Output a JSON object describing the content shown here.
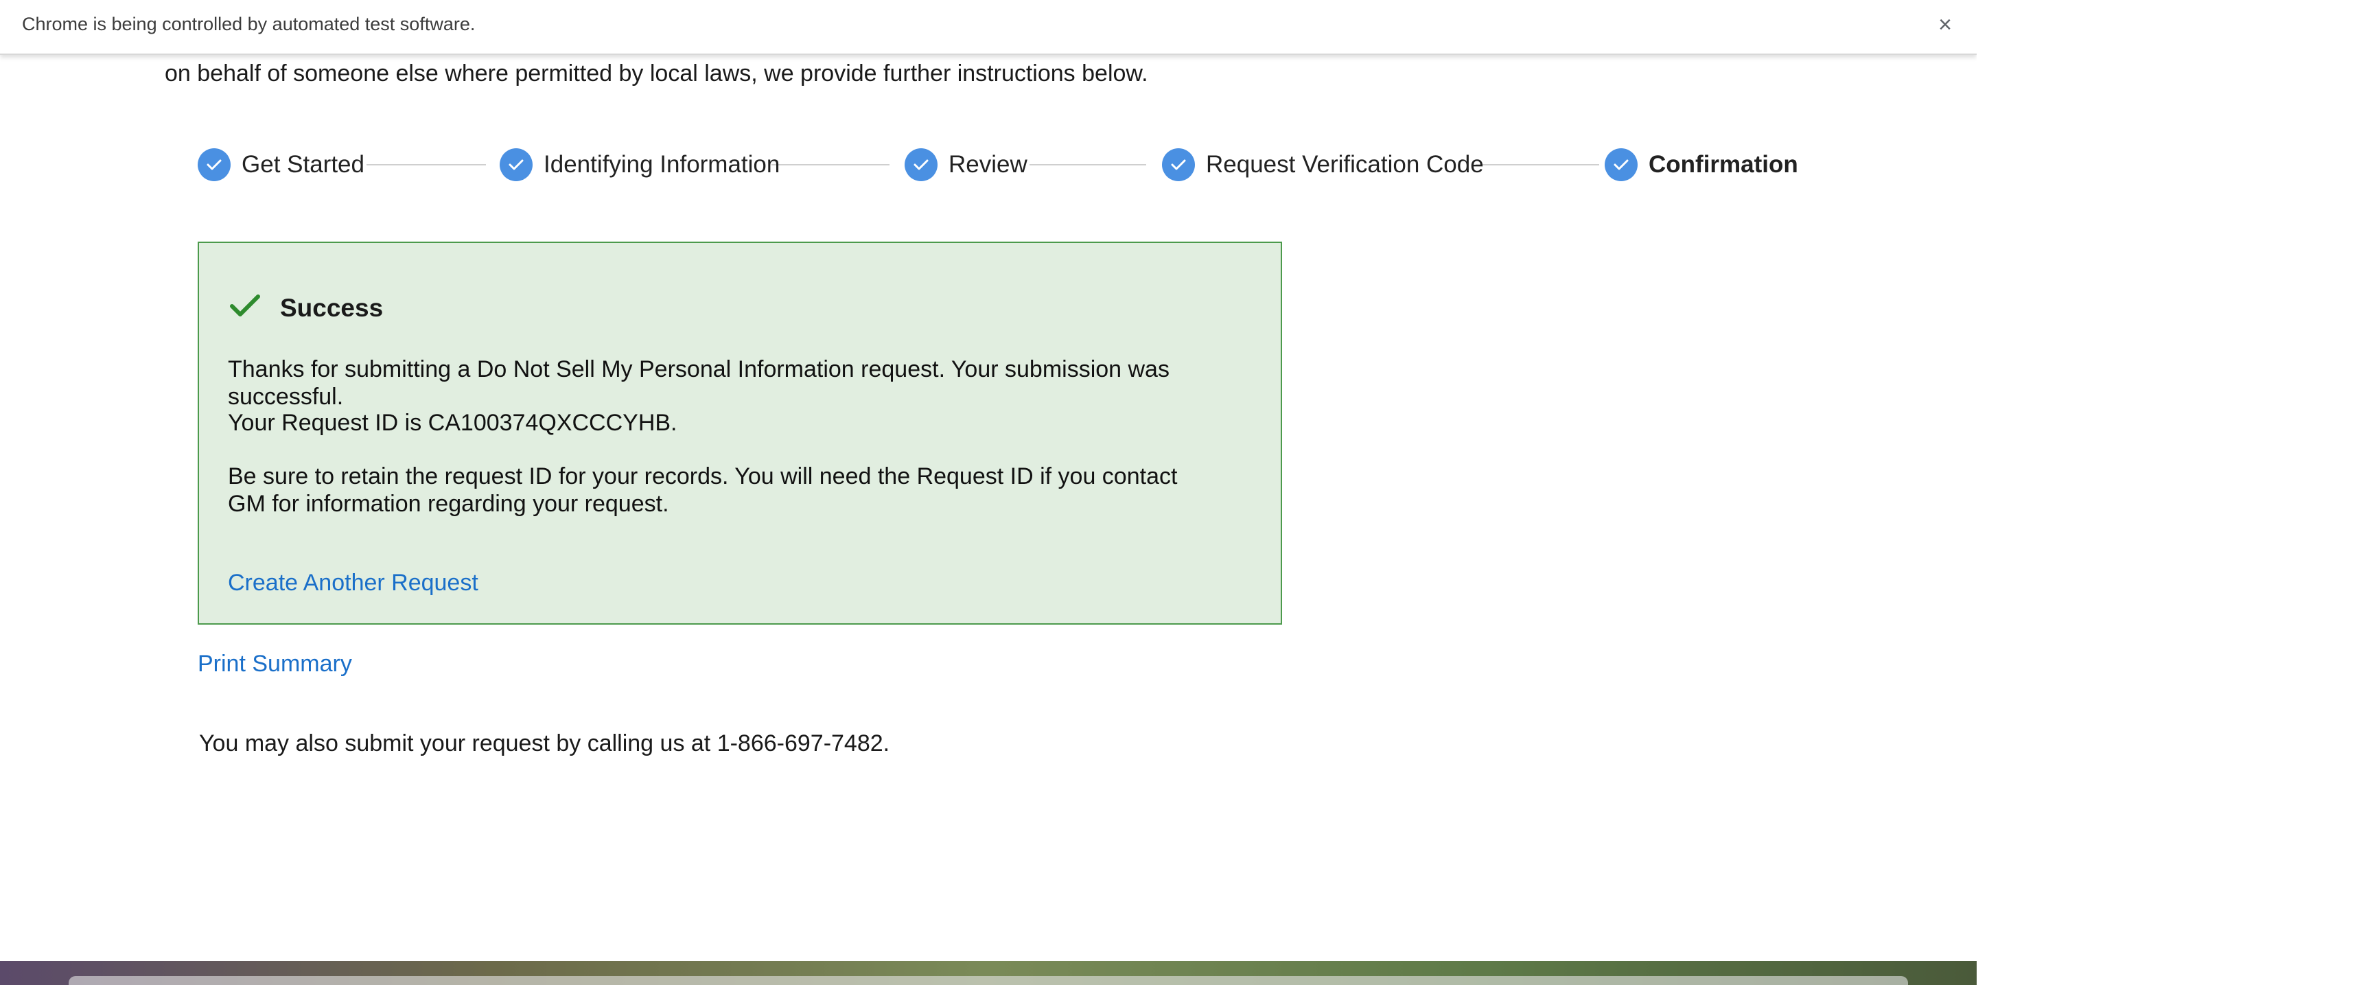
{
  "infobar": {
    "message": "Chrome is being controlled by automated test software.",
    "close_glyph": "×"
  },
  "intro": {
    "text": "on behalf of someone else where permitted by local laws, we provide further instructions below."
  },
  "stepper": {
    "steps": [
      {
        "label": "Get Started",
        "status": "complete"
      },
      {
        "label": "Identifying Information",
        "status": "complete"
      },
      {
        "label": "Review",
        "status": "complete"
      },
      {
        "label": "Request Verification Code",
        "status": "complete"
      },
      {
        "label": "Confirmation",
        "status": "current"
      }
    ]
  },
  "success": {
    "title": "Success",
    "message": "Thanks for submitting a Do Not Sell My Personal Information request. Your submission was successful.",
    "request_id_text": "Your Request ID is CA100374QXCCCYHB.",
    "retain_text": "Be sure to retain the request ID for your records. You will need the Request ID if you contact GM for information regarding your request.",
    "create_another_label": "Create Another Request"
  },
  "print_summary_label": "Print Summary",
  "call_text": "You may also submit your request by calling us at 1-866-697-7482.",
  "colors": {
    "step_check": "#4a90e2",
    "success_bg": "#e1eee0",
    "success_border": "#4c9a4c",
    "success_check": "#2e8b2e",
    "link": "#1a6fc9"
  },
  "icons": {
    "step_icon": "check-circle-icon",
    "success_icon": "checkmark-icon",
    "close_icon": "close-icon"
  }
}
